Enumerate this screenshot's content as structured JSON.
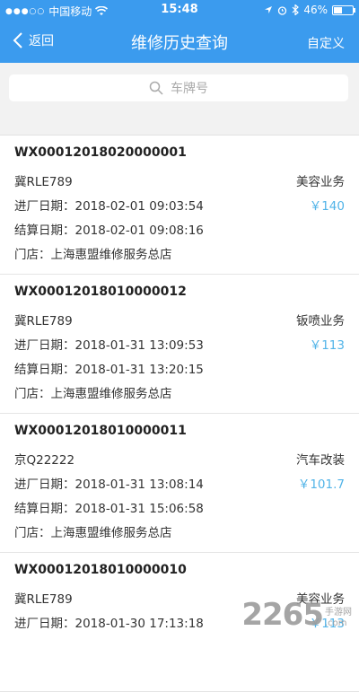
{
  "status_bar": {
    "carrier": "中国移动",
    "time": "15:48",
    "battery": "46%",
    "battery_level": 0.46
  },
  "nav": {
    "back_label": "返回",
    "title": "维修历史查询",
    "right_label": "自定义"
  },
  "search": {
    "placeholder": "车牌号"
  },
  "records": [
    {
      "order_no": "WX00012018020000001",
      "plate": "冀RLE789",
      "business": "美容业务",
      "price": "￥140",
      "entry": "进厂日期：2018-02-01 09:03:54",
      "settle": "结算日期：2018-02-01 09:08:16",
      "store": "门店：上海惠盟维修服务总店"
    },
    {
      "order_no": "WX00012018010000012",
      "plate": "冀RLE789",
      "business": "钣喷业务",
      "price": "￥113",
      "entry": "进厂日期：2018-01-31 13:09:53",
      "settle": "结算日期：2018-01-31 13:20:15",
      "store": "门店：上海惠盟维修服务总店"
    },
    {
      "order_no": "WX00012018010000011",
      "plate": "京Q22222",
      "business": "汽车改装",
      "price": "￥101.7",
      "entry": "进厂日期：2018-01-31 13:08:14",
      "settle": "结算日期：2018-01-31 15:06:58",
      "store": "门店：上海惠盟维修服务总店"
    },
    {
      "order_no": "WX00012018010000010",
      "plate": "冀RLE789",
      "business": "美容业务",
      "price": "￥113",
      "entry": "进厂日期：2018-01-30 17:13:18",
      "settle": "",
      "store": ""
    }
  ],
  "watermark": {
    "number": "2265",
    "line1": "手游网",
    "line2": ".com"
  },
  "colors": {
    "primary": "#3b9bee",
    "price": "#52b4e8"
  }
}
